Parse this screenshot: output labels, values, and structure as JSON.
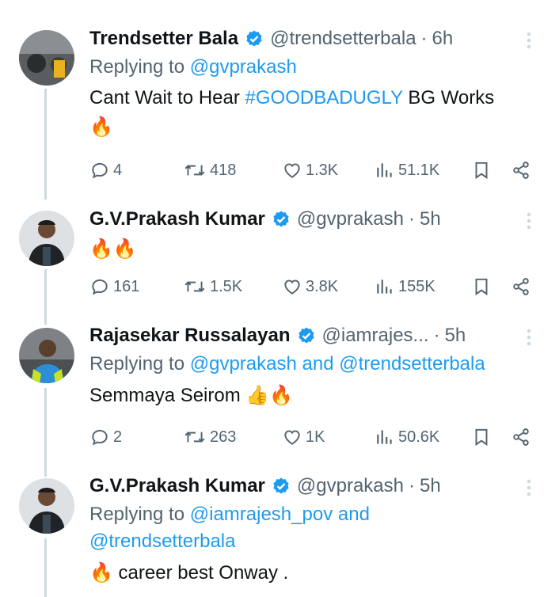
{
  "tweets": [
    {
      "name": "Trendsetter Bala",
      "handle": "@trendsetterbala",
      "time": "6h",
      "replying_prefix": "Replying to ",
      "replying_to": "@gvprakash",
      "text_before": "Cant Wait to Hear ",
      "hashtag": "#GOODBADUGLY",
      "text_after": " BG Works",
      "emoji": "🔥",
      "replies": "4",
      "reposts": "418",
      "likes": "1.3K",
      "views": "51.1K"
    },
    {
      "name": "G.V.Prakash Kumar",
      "handle": "@gvprakash",
      "time": "5h",
      "emoji": "🔥🔥",
      "replies": "161",
      "reposts": "1.5K",
      "likes": "3.8K",
      "views": "155K"
    },
    {
      "name": "Rajasekar Russalayan",
      "handle": "@iamrajes...",
      "time": "5h",
      "replying_prefix": "Replying to ",
      "replying_to_1": "@gvprakash",
      "replying_and": " and ",
      "replying_to_2": "@trendsetterbala",
      "text": "Semmaya Seirom ",
      "emoji": "👍🔥",
      "replies": "2",
      "reposts": "263",
      "likes": "1K",
      "views": "50.6K"
    },
    {
      "name": "G.V.Prakash Kumar",
      "handle": "@gvprakash",
      "time": "5h",
      "replying_prefix": "Replying to ",
      "replying_to_1": "@iamrajesh_pov",
      "replying_and": " and",
      "replying_to_2": "@trendsetterbala",
      "emoji": "🔥",
      "text": " career best Onway ."
    }
  ],
  "separator": "·",
  "colors": {
    "accent": "#1d9bf0",
    "muted": "#536471",
    "text": "#0f1419",
    "line": "#cfd9de"
  }
}
